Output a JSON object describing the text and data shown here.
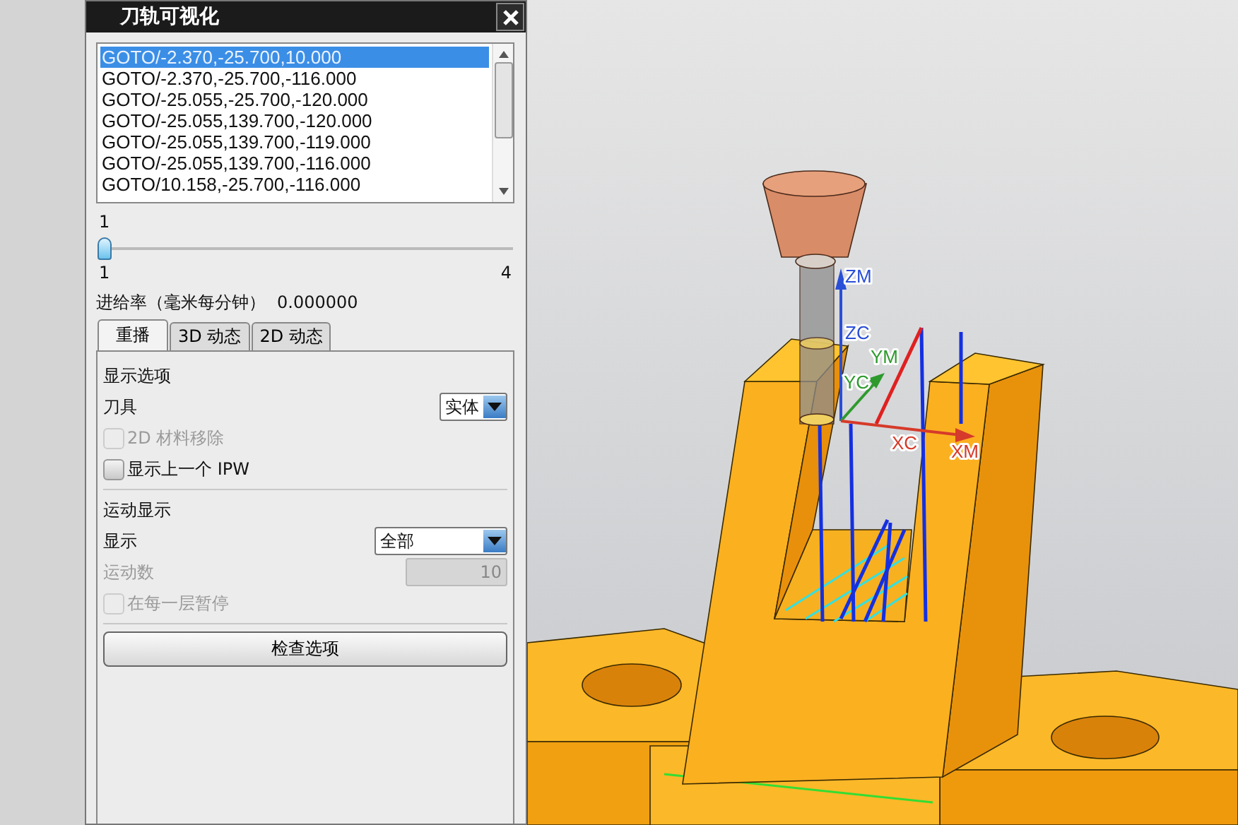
{
  "dialog": {
    "title": "刀轨可视化",
    "path_list": [
      {
        "text": "GOTO/-2.370,-25.700,10.000",
        "selected": true
      },
      {
        "text": "GOTO/-2.370,-25.700,-116.000",
        "selected": false
      },
      {
        "text": "GOTO/-25.055,-25.700,-120.000",
        "selected": false
      },
      {
        "text": "GOTO/-25.055,139.700,-120.000",
        "selected": false
      },
      {
        "text": "GOTO/-25.055,139.700,-119.000",
        "selected": false
      },
      {
        "text": "GOTO/-25.055,139.700,-116.000",
        "selected": false
      },
      {
        "text": "GOTO/10.158,-25.700,-116.000",
        "selected": false
      }
    ],
    "slider": {
      "value": "1",
      "min": "1",
      "max": "4",
      "level": 0
    },
    "feed_rate": {
      "label": "进给率（毫米每分钟）",
      "value": "0.000000"
    },
    "tabs": [
      {
        "label": "重播",
        "selected": true
      },
      {
        "label": "3D 动态",
        "selected": false
      },
      {
        "label": "2D 动态",
        "selected": false
      }
    ],
    "sections": [
      {
        "title": "显示选项",
        "rows": [
          {
            "kind": "dropdown",
            "label": "刀具",
            "value": "实体"
          },
          {
            "kind": "checkbox",
            "label": "2D 材料移除",
            "checked": false,
            "disabled": true
          },
          {
            "kind": "checkbox",
            "label": "显示上一个 IPW",
            "checked": false,
            "disabled": false
          }
        ]
      },
      {
        "title": "运动显示",
        "rows": [
          {
            "kind": "dropdown",
            "label": "显示",
            "value": "全部"
          },
          {
            "kind": "number",
            "label": "运动数",
            "value": "10",
            "disabled": true
          },
          {
            "kind": "checkbox",
            "label": "在每一层暂停",
            "checked": false,
            "disabled": true
          },
          {
            "kind": "button",
            "label": "检查选项"
          }
        ]
      }
    ]
  },
  "viewport": {
    "axis_labels": [
      {
        "text": "ZM",
        "color": "#2a4fd6"
      },
      {
        "text": "ZC",
        "color": "#2a4fd6"
      },
      {
        "text": "YM",
        "color": "#2e9a2e"
      },
      {
        "text": "YC",
        "color": "#2e9a2e"
      },
      {
        "text": "XC",
        "color": "#d63a2a"
      },
      {
        "text": "XM",
        "color": "#d63a2a"
      }
    ]
  }
}
